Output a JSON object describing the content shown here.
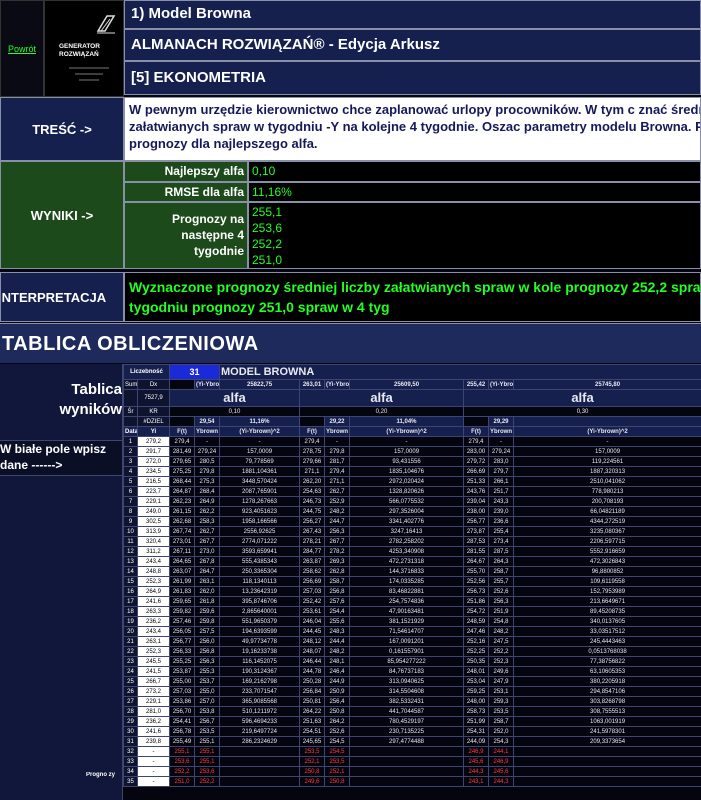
{
  "header": {
    "back": "Powrót",
    "logo_text": "GENERATOR ROZWIĄZAŃ",
    "model_title": "1) Model Browna",
    "almanac": "ALMANACH ROZWIĄZAŃ® - Edycja Arkusz",
    "section": "[5] EKONOMETRIA"
  },
  "tresc": {
    "label": "TREŚĆ ->",
    "text": "W pewnym urzędzie kierownictwo chce zaplanować urlopy procowników. W tym c znać średnią liczbę załatwianych spraw w tygodniu -Y na kolejne 4 tygodnie. Oszac parametry modelu Browna. Policz prognozy dla najlepszego alfa."
  },
  "wyniki": {
    "label": "WYNIKI ->",
    "best_alfa_label": "Najlepszy alfa",
    "best_alfa": "0,10",
    "rmse_label": "RMSE dla alfa",
    "rmse": "11,16%",
    "prognozy_label": "Prognozy na następne 4 tygodnie",
    "prognozy": [
      "255,1",
      "253,6",
      "252,2",
      "251,0"
    ]
  },
  "interpretacja": {
    "label": "INTERPRETACJA",
    "text": "Wyznaczone prognozy średniej liczby załatwianych spraw w kole prognozy 252,2 spraw w 3 tygodniu prognozy 251,0 spraw w 4 tyg"
  },
  "tablica_title": "TABLICA OBLICZENIOWA",
  "left_panel": {
    "title": "Tablica wyników",
    "instruction": "W białe pole wpisz dane ------>",
    "prognozy_label": "Progno zy"
  },
  "calc": {
    "liczebnosc_label": "Liczebność",
    "n": "31",
    "model": "MODEL BROWNA",
    "suma_label": "Suma",
    "suma": "7527,9",
    "sr_label": "Śr",
    "sr": "#DZIEL",
    "data_label": "Data",
    "yi_label": "Yi",
    "yi_dx": "Dx",
    "yi_kr": "KR",
    "alfa_label": "alfa",
    "groups": [
      {
        "sumy_label": "(Yi-Ybrown)",
        "suma": "25822,75",
        "suma2": "263,01",
        "alfa": "0,10",
        "rmse": "29,54",
        "rmse_pct": "11,16%"
      },
      {
        "sumy_label": "(Yi-Ybrown)",
        "suma": "25609,50",
        "suma2": "255,42",
        "alfa": "0,20",
        "rmse": "29,22",
        "rmse_pct": "11,04%"
      },
      {
        "sumy_label": "(Yi-Ybrown)",
        "suma": "25745,80",
        "suma2": "256",
        "alfa": "0,30",
        "rmse": "29,29",
        "rmse_pct": ""
      }
    ],
    "col_ft": "F(t)",
    "col_yb": "Ybrown",
    "col_sq": "(Yi-Ybrown)^2",
    "rows": [
      [
        "1",
        "279,2",
        "279,4",
        "-",
        "-",
        "279,4",
        "-",
        "-",
        "279,4",
        "-",
        "-"
      ],
      [
        "2",
        "291,7",
        "281,49",
        "279,24",
        "157,0009",
        "278,75",
        "279,8",
        "157,0009",
        "283,00",
        "279,24",
        "157,0009"
      ],
      [
        "3",
        "272,0",
        "279,65",
        "280,5",
        "79,778569",
        "279,66",
        "281,7",
        "93,431556",
        "279,72",
        "283,0",
        "119,224561"
      ],
      [
        "4",
        "234,5",
        "275,25",
        "279,8",
        "1881,104361",
        "271,1",
        "279,4",
        "1835,104676",
        "266,69",
        "279,7",
        "1887,320313"
      ],
      [
        "5",
        "216,5",
        "268,44",
        "275,3",
        "3448,570424",
        "262,20",
        "271,1",
        "2972,020424",
        "251,33",
        "266,1",
        "2510,041062"
      ],
      [
        "6",
        "223,7",
        "264,87",
        "268,4",
        "2087,765901",
        "254,63",
        "262,7",
        "1328,820626",
        "243,76",
        "251,7",
        "778,980213"
      ],
      [
        "7",
        "229,1",
        "262,23",
        "264,9",
        "1278,267663",
        "246,73",
        "252,9",
        "566,0775532",
        "239,04",
        "243,3",
        "200,708193"
      ],
      [
        "8",
        "249,0",
        "261,15",
        "262,2",
        "923,4051623",
        "244,75",
        "248,2",
        "297,3526004",
        "238,00",
        "239,0",
        "66,04821189"
      ],
      [
        "9",
        "302,5",
        "262,68",
        "258,3",
        "1958,166566",
        "256,27",
        "244,7",
        "3341,402776",
        "256,77",
        "236,6",
        "4344,272519"
      ],
      [
        "10",
        "313,9",
        "267,74",
        "262,7",
        "2556,92625",
        "267,43",
        "256,3",
        "3247,16413",
        "273,87",
        "255,4",
        "3235,080367"
      ],
      [
        "11",
        "320,4",
        "273,01",
        "267,7",
        "2774,071222",
        "278,21",
        "267,7",
        "2782,258202",
        "287,53",
        "273,4",
        "2206,597715"
      ],
      [
        "12",
        "311,2",
        "267,11",
        "273,0",
        "3593,659941",
        "284,77",
        "278,2",
        "4253,340908",
        "281,55",
        "287,5",
        "5552,916659"
      ],
      [
        "13",
        "243,4",
        "264,65",
        "267,8",
        "555,4385343",
        "263,87",
        "269,3",
        "472,2731318",
        "264,67",
        "264,3",
        "472,3026843"
      ],
      [
        "14",
        "248,8",
        "263,07",
        "264,7",
        "250,3365304",
        "258,62",
        "262,8",
        "144,3716833",
        "255,70",
        "258,7",
        "96,8800852"
      ],
      [
        "15",
        "252,3",
        "261,99",
        "263,1",
        "118,1340113",
        "256,69",
        "258,7",
        "174,0335285",
        "252,56",
        "255,7",
        "109,6119558"
      ],
      [
        "16",
        "264,9",
        "261,83",
        "262,0",
        "13,23642319",
        "257,03",
        "256,8",
        "83,46822881",
        "256,73",
        "252,6",
        "152,7953989"
      ],
      [
        "17",
        "241,6",
        "259,65",
        "261,8",
        "395,8746706",
        "252,42",
        "257,6",
        "254,7574836",
        "251,86",
        "256,3",
        "213,6649671"
      ],
      [
        "18",
        "263,3",
        "259,82",
        "259,6",
        "2,865640001",
        "253,61",
        "254,4",
        "47,90163481",
        "254,72",
        "251,9",
        "89,45208735"
      ],
      [
        "19",
        "236,2",
        "257,46",
        "259,8",
        "551,9650379",
        "246,04",
        "255,6",
        "381,1521929",
        "248,59",
        "254,8",
        "340,0137605"
      ],
      [
        "20",
        "243,4",
        "256,05",
        "257,5",
        "194,6393599",
        "244,45",
        "248,3",
        "71,54614707",
        "247,46",
        "248,2",
        "33,03517512"
      ],
      [
        "21",
        "263,1",
        "256,77",
        "256,0",
        "49,97734778",
        "248,12",
        "244,4",
        "167,0091201",
        "252,16",
        "247,5",
        "245,4443463"
      ],
      [
        "22",
        "252,3",
        "256,33",
        "256,8",
        "19,16233738",
        "248,07",
        "248,2",
        "0,161557901",
        "252,25",
        "252,2",
        "0,0513768038"
      ],
      [
        "23",
        "245,5",
        "255,25",
        "256,3",
        "116,1452075",
        "246,44",
        "248,1",
        "85,954277222",
        "250,35",
        "252,3",
        "77,38756822"
      ],
      [
        "24",
        "241,5",
        "253,87",
        "255,3",
        "190,3124367",
        "244,78",
        "246,4",
        "84,76737183",
        "248,01",
        "249,6",
        "63,10605353"
      ],
      [
        "25",
        "266,7",
        "255,00",
        "253,7",
        "169,2162798",
        "250,28",
        "244,9",
        "313,0940625",
        "253,04",
        "247,9",
        "380,2205918"
      ],
      [
        "26",
        "273,2",
        "257,03",
        "255,0",
        "233,7071547",
        "256,84",
        "250,9",
        "314,5504608",
        "259,25",
        "253,1",
        "294,8547106"
      ],
      [
        "27",
        "229,1",
        "253,86",
        "257,0",
        "365,9085568",
        "250,81",
        "256,4",
        "382,5332431",
        "248,00",
        "259,3",
        "303,8268798"
      ],
      [
        "28",
        "281,0",
        "256,70",
        "253,8",
        "510,1211972",
        "264,22",
        "250,8",
        "441,7044587",
        "258,73",
        "253,5",
        "308,7555513"
      ],
      [
        "29",
        "236,2",
        "254,41",
        "256,7",
        "596,4694233",
        "251,63",
        "264,2",
        "780,4529197",
        "251,99",
        "258,7",
        "1063,001919"
      ],
      [
        "30",
        "241,6",
        "256,78",
        "253,5",
        "219,6497724",
        "254,51",
        "252,6",
        "230,7135225",
        "254,31",
        "252,0",
        "241,5978301"
      ],
      [
        "31",
        "239,8",
        "255,49",
        "255,1",
        "286,2324629",
        "245,65",
        "254,5",
        "297,4774488",
        "244,09",
        "254,3",
        "209,3373654"
      ]
    ],
    "forecast": [
      [
        "32",
        "-",
        "255,1",
        "255,1",
        "",
        "253,5",
        "254,5",
        "",
        "246,9",
        "244,1",
        ""
      ],
      [
        "33",
        "-",
        "253,6",
        "255,1",
        "",
        "252,1",
        "253,5",
        "",
        "245,6",
        "246,9",
        ""
      ],
      [
        "34",
        "-",
        "252,2",
        "253,6",
        "",
        "250,8",
        "252,1",
        "",
        "244,3",
        "245,6",
        ""
      ],
      [
        "35",
        "-",
        "251,0",
        "252,2",
        "",
        "249,6",
        "250,8",
        "",
        "243,1",
        "244,3",
        ""
      ]
    ]
  }
}
